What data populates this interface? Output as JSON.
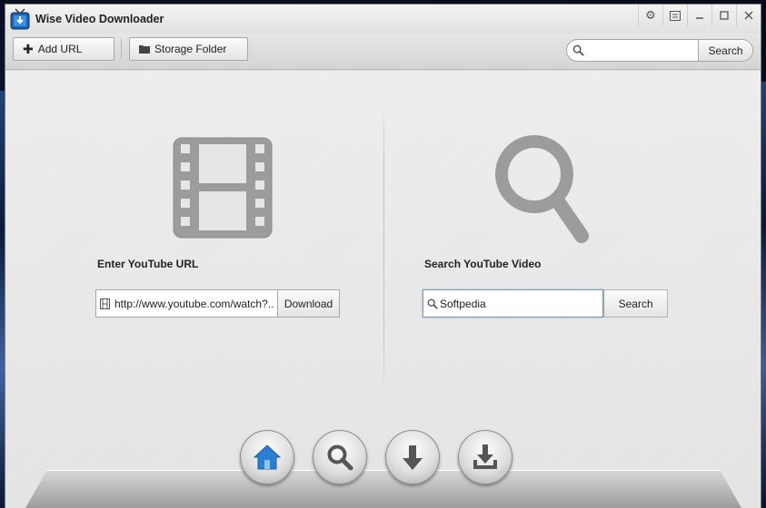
{
  "window": {
    "title": "Wise Video Downloader"
  },
  "title_controls": [
    "gear-icon",
    "feedback-icon",
    "minimize-icon",
    "maximize-icon",
    "close-icon"
  ],
  "toolbar": {
    "add_url_label": "Add URL",
    "storage_folder_label": "Storage Folder",
    "search_placeholder": "",
    "search_button_label": "Search"
  },
  "url_section": {
    "label": "Enter YouTube URL",
    "input_value": "http://www.youtube.com/watch?...",
    "button_label": "Download"
  },
  "search_section": {
    "label": "Search YouTube Video",
    "input_value": "Softpedia",
    "button_label": "Search"
  },
  "dock": {
    "items": [
      {
        "name": "home",
        "icon": "house-icon",
        "active": true
      },
      {
        "name": "search",
        "icon": "magnifier-icon",
        "active": false
      },
      {
        "name": "downloading",
        "icon": "down-arrow-icon",
        "active": false
      },
      {
        "name": "downloaded",
        "icon": "download-tray-icon",
        "active": false
      }
    ]
  },
  "colors": {
    "accent_blue": "#2a7fd4",
    "icon_gray": "#9a9a9a",
    "focus_border": "#5aa0e0"
  }
}
